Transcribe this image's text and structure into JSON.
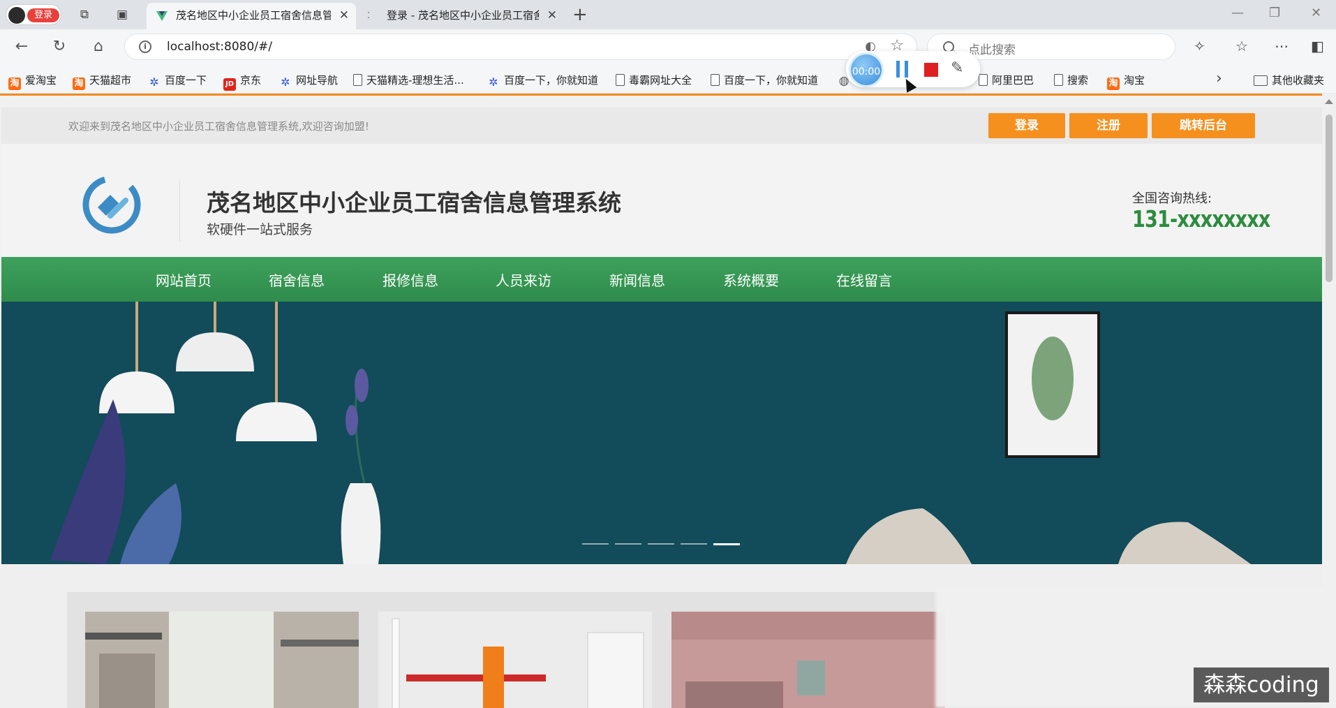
{
  "browser": {
    "profile_label": "登录",
    "tabs": [
      {
        "title": "茂名地区中小企业员工宿舍信息管",
        "active": true
      },
      {
        "title": "登录 - 茂名地区中小企业员工宿舍",
        "active": false
      }
    ],
    "url": "localhost:8080/#/",
    "search_placeholder": "点此搜索",
    "bookmarks": [
      {
        "label": "爱淘宝",
        "icon": "taobao-icon"
      },
      {
        "label": "天猫超市",
        "icon": "taobao-icon"
      },
      {
        "label": "百度一下",
        "icon": "baidu-paw-icon"
      },
      {
        "label": "京东",
        "icon": "jd-icon"
      },
      {
        "label": "网址导航",
        "icon": "baidu-paw-icon"
      },
      {
        "label": "天猫精选-理想生活...",
        "icon": "document-icon"
      },
      {
        "label": "百度一下，你就知道",
        "icon": "baidu-paw-icon"
      },
      {
        "label": "毒霸网址大全",
        "icon": "document-icon"
      },
      {
        "label": "百度一下，你就知道",
        "icon": "document-icon"
      },
      {
        "label": "阿里巴巴",
        "icon": "document-icon"
      },
      {
        "label": "搜索",
        "icon": "document-icon"
      },
      {
        "label": "淘宝",
        "icon": "taobao-icon"
      }
    ],
    "other_bookmarks": "其他收藏夹"
  },
  "recorder": {
    "timer": "00:00"
  },
  "site": {
    "welcome": "欢迎来到茂名地区中小企业员工宿舍信息管理系统,欢迎咨询加盟!",
    "buttons": {
      "login": "登录",
      "register": "注册",
      "admin": "跳转后台"
    },
    "title": "茂名地区中小企业员工宿舍信息管理系统",
    "subtitle": "软硬件一站式服务",
    "hotline_label": "全国咨询热线:",
    "hotline_number": "131-xxxxxxxx",
    "nav": [
      "网站首页",
      "宿舍信息",
      "报修信息",
      "人员来访",
      "新闻信息",
      "系统概要",
      "在线留言"
    ],
    "carousel": {
      "slides": 5,
      "active_index": 4
    }
  },
  "colors": {
    "accent_orange": "#f5901e",
    "nav_green": "#2f8c4c",
    "banner_teal": "#124b5a",
    "hotline_green": "#2e8b3e"
  },
  "watermark": "森森coding"
}
